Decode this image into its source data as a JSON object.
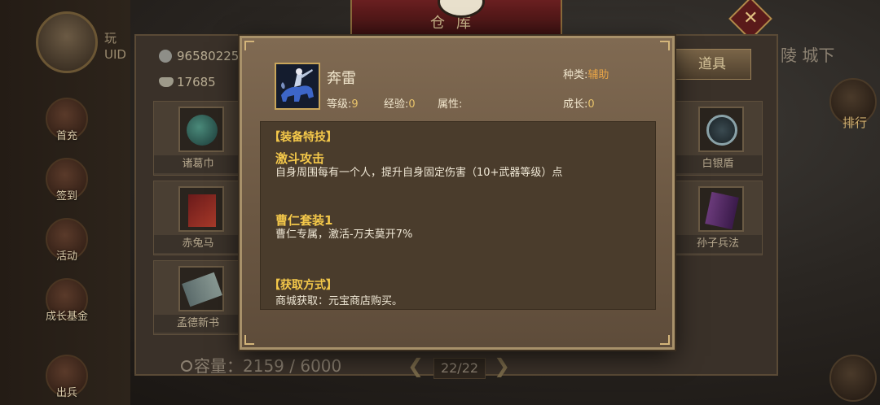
{
  "background": {
    "player": {
      "name_partial": "玩",
      "uid_label": "UID"
    },
    "window_title": "仓库",
    "side_menu": [
      "首充",
      "签到",
      "活动",
      "成长基金",
      "出兵"
    ],
    "currency": {
      "coins": "96580225",
      "ingots": "17685"
    },
    "tab_active": "道具",
    "top_right_text": "陵  城下",
    "right_menu_label": "排行",
    "items": [
      "诸葛巾",
      "赤兔马",
      "孟德新书",
      "白银盾",
      "孙子兵法"
    ],
    "capacity": "容量：2159 / 6000",
    "pager": "22/22"
  },
  "modal": {
    "item_name": "奔雷",
    "kind_label": "种类:",
    "kind_value": "辅助",
    "level_label": "等级:",
    "level_value": "9",
    "exp_label": "经验:",
    "exp_value": "0",
    "attr_label": "属性:",
    "growth_label": "成长:",
    "growth_value": "0",
    "sections": {
      "equip_skill_title": "【装备特技】",
      "skill1_name": "激斗攻击",
      "skill1_desc": "自身周围每有一个人，提升自身固定伤害（10+武器等级）点",
      "skill2_name": "曹仁套装1",
      "skill2_desc": "曹仁专属，激活-万夫莫开7%",
      "source_title": "【获取方式】",
      "source_desc": "商城获取：元宝商店购买。"
    }
  }
}
